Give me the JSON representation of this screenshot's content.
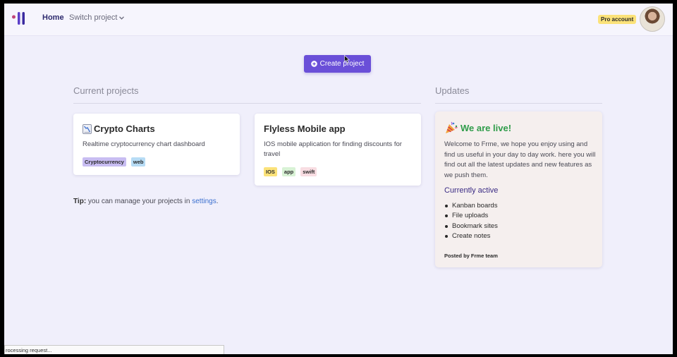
{
  "nav": {
    "home": "Home",
    "switch_project": "Switch project",
    "pro_badge": "Pro account"
  },
  "actions": {
    "create_project": "Create project"
  },
  "current_projects": {
    "title": "Current projects",
    "projects": [
      {
        "name": "Crypto Charts",
        "icon": "chart-icon",
        "description": "Realtime cryptocurrency chart dashboard",
        "tags": [
          {
            "label": "Cryptocurrency",
            "color": "#c8bdf2"
          },
          {
            "label": "web",
            "color": "#b7dcf5"
          }
        ]
      },
      {
        "name": "Flyless Mobile app",
        "description": "IOS mobile application for finding discounts for travel",
        "tags": [
          {
            "label": "IOS",
            "color": "#fbe27a"
          },
          {
            "label": "app",
            "color": "#d8f2d5"
          },
          {
            "label": "swift",
            "color": "#f8dde2"
          }
        ]
      }
    ],
    "tip_label": "Tip:",
    "tip_text": " you can manage your projects in ",
    "tip_link": "settings",
    "tip_end": "."
  },
  "updates": {
    "title": "Updates",
    "headline": "We are live!",
    "headline_icon": "party-popper-icon",
    "body": "Welcome to Frme, we hope you enjoy using and find us useful in your day to day work. here you will find out all the latest updates and new features as we push them.",
    "subheading": "Currently active",
    "features": [
      "Kanban boards",
      "File uploads",
      "Bookmark sites",
      "Create notes"
    ],
    "footer": "Posted by Frme team"
  },
  "status_bar": {
    "text": "rocessing request..."
  },
  "colors": {
    "primary": "#6a4fd8",
    "background": "#f0effb",
    "headline_green": "#2f9c4a",
    "link": "#3a6fcf"
  }
}
